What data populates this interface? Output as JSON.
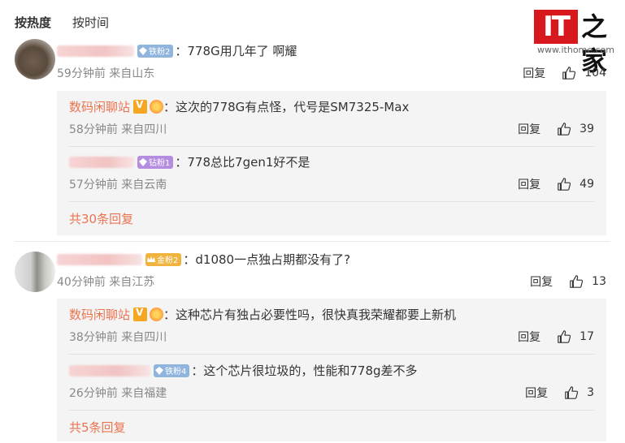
{
  "sort": {
    "hot": "按热度",
    "time": "按时间"
  },
  "logo": {
    "brand": "IT",
    "brand_zh": "之家",
    "url": "www.ithome.com"
  },
  "comments": [
    {
      "badge": "铁粉2",
      "text": "778G用几年了 啊耀",
      "meta": "59分钟前 来自山东",
      "reply_label": "回复",
      "likes": "104",
      "replies": [
        {
          "author": "数码闲聊站",
          "text": "这次的778G有点怪，代号是SM7325-Max",
          "meta": "58分钟前 来自四川",
          "reply_label": "回复",
          "likes": "39"
        },
        {
          "badge": "钻粉1",
          "text": "778总比7gen1好不是",
          "meta": "57分钟前 来自云南",
          "reply_label": "回复",
          "likes": "49"
        }
      ],
      "more": "共30条回复"
    },
    {
      "badge": "金粉2",
      "text": "d1080一点独占期都没有了?",
      "meta": "40分钟前 来自江苏",
      "reply_label": "回复",
      "likes": "13",
      "replies": [
        {
          "author": "数码闲聊站",
          "text": "这种芯片有独占必要性吗，很快真我荣耀都要上新机",
          "meta": "38分钟前 来自四川",
          "reply_label": "回复",
          "likes": "17"
        },
        {
          "badge": "铁粉4",
          "text": "这个芯片很垃圾的，性能和778g差不多",
          "meta": "26分钟前 来自福建",
          "reply_label": "回复",
          "likes": "3"
        }
      ],
      "more": "共5条回复"
    }
  ]
}
